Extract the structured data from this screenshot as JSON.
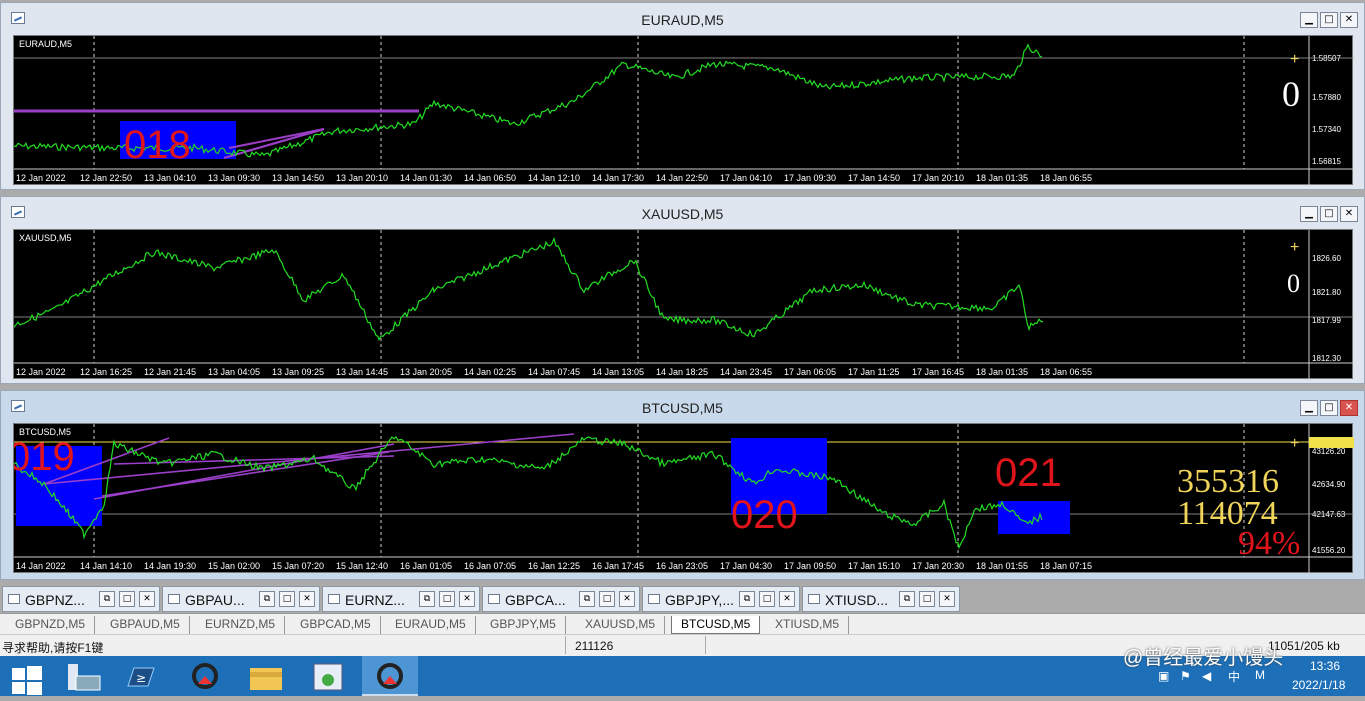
{
  "windows": [
    {
      "title": "EURAUD,M5",
      "symbol": "EURAUD,M5",
      "price_labels": [
        "1.58507",
        "1.57880",
        "1.57340",
        "1.56815"
      ],
      "time_labels": [
        "12 Jan 2022",
        "12 Jan 22:50",
        "13 Jan 04:10",
        "13 Jan 09:30",
        "13 Jan 14:50",
        "13 Jan 20:10",
        "14 Jan 01:30",
        "14 Jan 06:50",
        "14 Jan 12:10",
        "14 Jan 17:30",
        "14 Jan 22:50",
        "17 Jan 04:10",
        "17 Jan 09:30",
        "17 Jan 14:50",
        "17 Jan 20:10",
        "18 Jan 01:35",
        "18 Jan 06:55"
      ],
      "overlay_number": "0",
      "annotation": "018",
      "plus": "+"
    },
    {
      "title": "XAUUSD,M5",
      "symbol": "XAUUSD,M5",
      "price_labels": [
        "1826.60",
        "1821.80",
        "1817.99",
        "1812.30"
      ],
      "time_labels": [
        "12 Jan 2022",
        "12 Jan 16:25",
        "12 Jan 21:45",
        "13 Jan 04:05",
        "13 Jan 09:25",
        "13 Jan 14:45",
        "13 Jan 20:05",
        "14 Jan 02:25",
        "14 Jan 07:45",
        "14 Jan 13:05",
        "14 Jan 18:25",
        "14 Jan 23:45",
        "17 Jan 06:05",
        "17 Jan 11:25",
        "17 Jan 16:45",
        "18 Jan 01:35",
        "18 Jan 06:55"
      ],
      "overlay_number": "0",
      "plus": "+"
    },
    {
      "title": "BTCUSD,M5",
      "symbol": "BTCUSD,M5",
      "price_labels": [
        "43288.36",
        "43126.20",
        "42634.90",
        "42147.63",
        "41556.20"
      ],
      "time_labels": [
        "14 Jan 2022",
        "14 Jan 14:10",
        "14 Jan 19:30",
        "15 Jan 02:00",
        "15 Jan 07:20",
        "15 Jan 12:40",
        "16 Jan 01:05",
        "16 Jan 07:05",
        "16 Jan 12:25",
        "16 Jan 17:45",
        "16 Jan 23:05",
        "17 Jan 04:30",
        "17 Jan 09:50",
        "17 Jan 15:10",
        "17 Jan 20:30",
        "18 Jan 01:55",
        "18 Jan 07:15"
      ],
      "annotations": [
        "019",
        "020",
        "021"
      ],
      "stats": [
        "355316",
        "114074",
        "94%"
      ],
      "plus": "+"
    }
  ],
  "window_buttons": {
    "min": "▁",
    "max": "□",
    "close": "✕"
  },
  "mdi_tabs": [
    "GBPNZ...",
    "GBPAU...",
    "EURNZ...",
    "GBPCA...",
    "GBPJPY,...",
    "XTIUSD..."
  ],
  "sheet_tabs": [
    "GBPNZD,M5",
    "GBPAUD,M5",
    "EURNZD,M5",
    "GBPCAD,M5",
    "EURAUD,M5",
    "GBPJPY,M5",
    "XAUUSD,M5",
    "BTCUSD,M5",
    "XTIUSD,M5"
  ],
  "active_sheet": "BTCUSD,M5",
  "status": {
    "help": "寻求帮助,请按F1键",
    "code": "211126",
    "traffic": "11051/205 kb"
  },
  "tray": {
    "time": "13:36",
    "date": "2022/1/18",
    "ime": "中",
    "m": "M"
  },
  "watermark": "@曾经最爱小馒头",
  "colors": {
    "line": "#22dd22",
    "box": "#0000ff",
    "annot": "#e0141b",
    "stat": "#f1d45a",
    "trend": "#9b3fc9"
  }
}
